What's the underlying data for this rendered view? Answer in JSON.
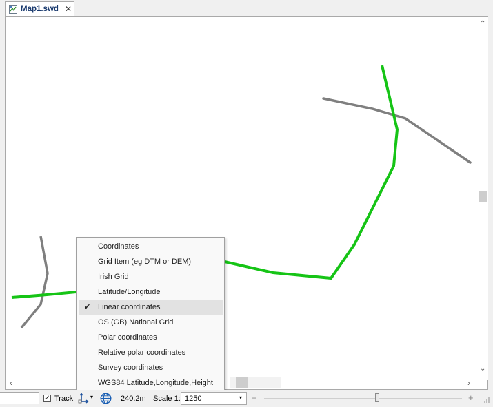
{
  "tab": {
    "title": "Map1.swd",
    "close_glyph": "✕",
    "doc_icon": "map-document-icon"
  },
  "map": {
    "green_line_color": "#16c416",
    "grey_line_color": "#7f7f7f"
  },
  "scrollbar": {
    "up_glyph": "⌃",
    "down_glyph": "⌄",
    "left_glyph": "‹",
    "right_glyph": "›"
  },
  "context_menu": {
    "items": [
      {
        "label": "Coordinates",
        "checked": false
      },
      {
        "label": "Grid Item (eg DTM or DEM)",
        "checked": false
      },
      {
        "label": "Irish Grid",
        "checked": false
      },
      {
        "label": "Latitude/Longitude",
        "checked": false
      },
      {
        "label": "Linear coordinates",
        "checked": true
      },
      {
        "label": "OS (GB) National Grid",
        "checked": false
      },
      {
        "label": "Polar coordinates",
        "checked": false
      },
      {
        "label": "Relative polar coordinates",
        "checked": false
      },
      {
        "label": "Survey coordinates",
        "checked": false
      },
      {
        "label": "WGS84 Latitude,Longitude,Height",
        "checked": false
      }
    ],
    "check_glyph": "✔"
  },
  "status": {
    "track_checked": true,
    "track_check_glyph": "✓",
    "track_label": "Track",
    "coordinate_icon": "coordinate-system-icon",
    "dropdown_glyph": "▾",
    "globe_icon": "globe-icon",
    "distance": "240.2m",
    "scale_label": "Scale 1:",
    "scale_value": "1250",
    "zoom_minus": "−",
    "zoom_plus": "+",
    "zoom_level": 0.57
  }
}
